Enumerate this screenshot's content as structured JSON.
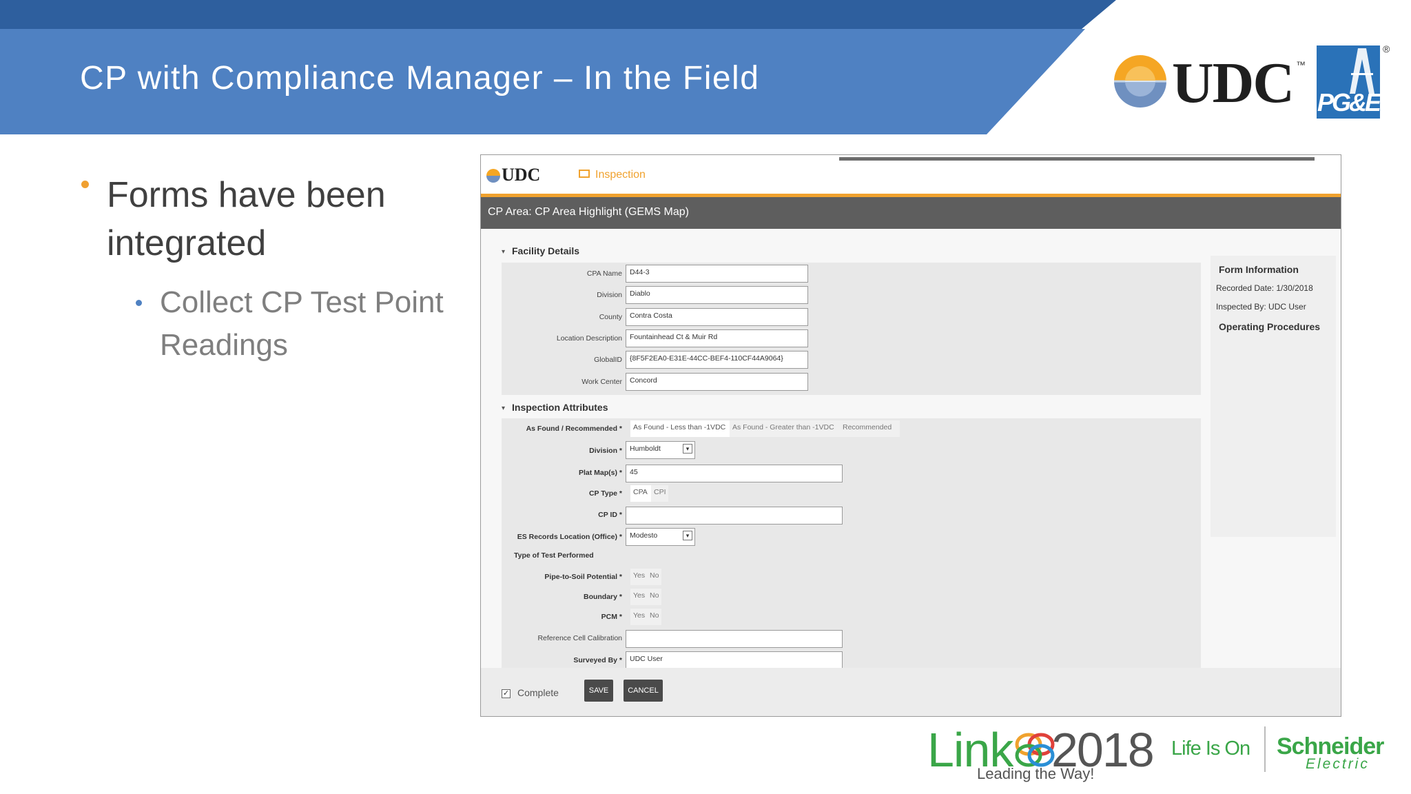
{
  "slide": {
    "title": "CP with Compliance Manager – In the Field",
    "bullets": [
      {
        "text": "Forms have been integrated"
      },
      {
        "text": "Collect CP Test Point Readings"
      }
    ]
  },
  "logos": {
    "udc": "UDC",
    "udc_tm": "™",
    "pge": "PG&E",
    "pge_reg": "®",
    "link": "Link",
    "link_year": "2018",
    "link_tagline": "Leading the Way!",
    "life_is_on": "Life Is On",
    "schneider": "Schneider",
    "electric": "Electric"
  },
  "colors": {
    "header_dark": "#2e5f9e",
    "header_band": "#4f81c2",
    "accent_orange": "#f0a22e",
    "brand_green": "#3aa648"
  },
  "app": {
    "logo": "UDC",
    "tab_icon": "table-icon",
    "tab_label": "Inspection",
    "breadcrumb": "CP Area: CP Area Highlight (GEMS Map)",
    "facility": {
      "heading": "Facility Details",
      "fields": [
        {
          "label": "CPA Name",
          "value": "D44-3"
        },
        {
          "label": "Division",
          "value": "Diablo"
        },
        {
          "label": "County",
          "value": "Contra Costa"
        },
        {
          "label": "Location Description",
          "value": "Fountainhead Ct & Muir Rd"
        },
        {
          "label": "GlobalID",
          "value": "{8F5F2EA0-E31E-44CC-BEF4-110CF44A9064}"
        },
        {
          "label": "Work Center",
          "value": "Concord"
        }
      ]
    },
    "inspection": {
      "heading": "Inspection Attributes",
      "as_found_label": "As Found / Recommended *",
      "as_found_options": [
        "As Found - Less than -1VDC",
        "As Found - Greater than -1VDC",
        "Recommended"
      ],
      "division_label": "Division *",
      "division_value": "Humboldt",
      "plat_label": "Plat Map(s) *",
      "plat_value": "45",
      "cp_type_label": "CP Type *",
      "cp_type_options": [
        "CPA",
        "CPI"
      ],
      "cp_id_label": "CP ID *",
      "cp_id_value": "",
      "es_label": "ES Records Location (Office) *",
      "es_value": "Modesto",
      "test_heading": "Type of Test Performed",
      "tests": [
        {
          "label": "Pipe-to-Soil Potential *",
          "yes": "Yes",
          "no": "No"
        },
        {
          "label": "Boundary *",
          "yes": "Yes",
          "no": "No"
        },
        {
          "label": "PCM *",
          "yes": "Yes",
          "no": "No"
        }
      ],
      "ref_label": "Reference Cell Calibration",
      "ref_value": "",
      "surveyed_label": "Surveyed By *",
      "surveyed_value": "UDC User"
    },
    "form_info": {
      "heading": "Form Information",
      "recorded": "Recorded Date: 1/30/2018",
      "inspected": "Inspected By: UDC User",
      "procedures": "Operating Procedures"
    },
    "footer": {
      "complete_label": "Complete",
      "complete_checked": true,
      "save": "SAVE",
      "cancel": "CANCEL"
    }
  }
}
